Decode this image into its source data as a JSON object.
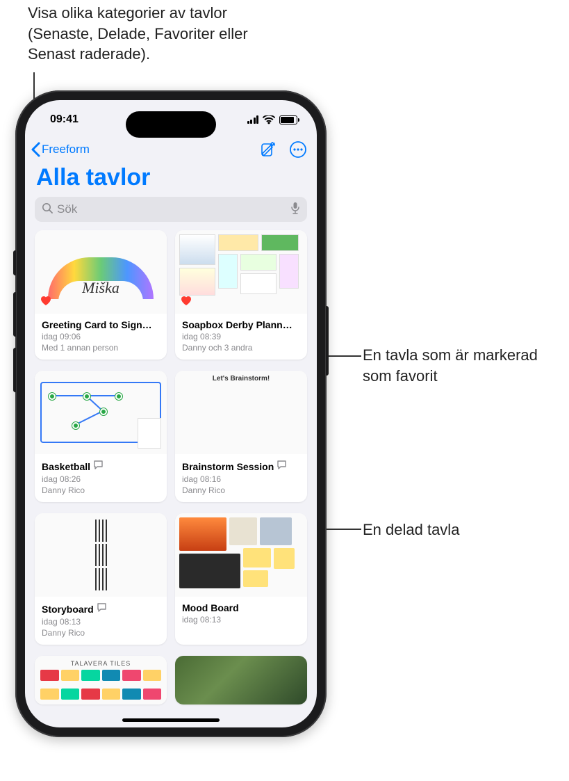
{
  "callouts": {
    "top": "Visa olika kategorier av tavlor (Senaste, Delade, Favoriter eller Senast raderade).",
    "favorite": "En tavla som är markerad som favorit",
    "shared": "En delad tavla"
  },
  "status": {
    "time": "09:41"
  },
  "nav": {
    "back_label": "Freeform"
  },
  "page": {
    "title": "Alla tavlor"
  },
  "search": {
    "placeholder": "Sök"
  },
  "boards": [
    {
      "title": "Greeting Card to Sign…",
      "time": "idag 09:06",
      "sub": "Med 1 annan person",
      "favorite": true,
      "shared": false
    },
    {
      "title": "Soapbox Derby Plann…",
      "time": "idag 08:39",
      "sub": "Danny och 3 andra",
      "favorite": true,
      "shared": false
    },
    {
      "title": "Basketball",
      "time": "idag 08:26",
      "sub": "Danny Rico",
      "favorite": false,
      "shared": true
    },
    {
      "title": "Brainstorm Session",
      "time": "idag 08:16",
      "sub": "Danny Rico",
      "favorite": false,
      "shared": true,
      "thumb_title": "Let's Brainstorm!"
    },
    {
      "title": "Storyboard",
      "time": "idag 08:13",
      "sub": "Danny Rico",
      "favorite": false,
      "shared": true
    },
    {
      "title": "Mood Board",
      "time": "idag 08:13",
      "sub": "",
      "favorite": false,
      "shared": false
    }
  ],
  "partial_boards_thumb_title": "TALAVERA TILES"
}
